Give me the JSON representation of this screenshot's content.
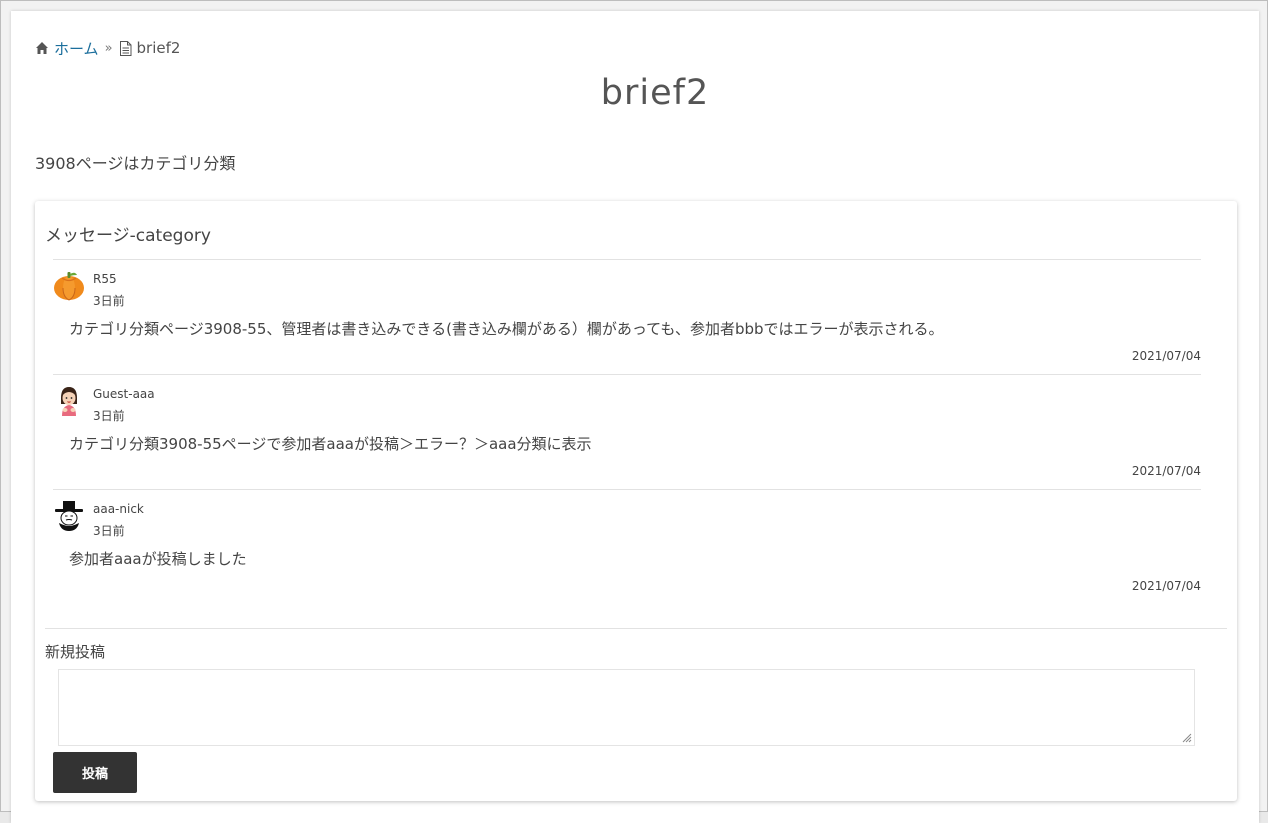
{
  "breadcrumb": {
    "home_label": "ホーム",
    "separator": "»",
    "current": "brief2"
  },
  "page": {
    "title": "brief2",
    "intro": "3908ページはカテゴリ分類"
  },
  "message_card": {
    "title": "メッセージ-category",
    "messages": [
      {
        "author": "R55",
        "ago": "3日前",
        "body": "カテゴリ分類ページ3908-55、管理者は書き込みできる(書き込み欄がある）欄があっても、参加者bbbではエラーが表示される。",
        "date": "2021/07/04",
        "avatar": "pumpkin-icon"
      },
      {
        "author": "Guest-aaa",
        "ago": "3日前",
        "body": "カテゴリ分類3908-55ページで参加者aaaが投稿＞エラー？＞aaa分類に表示",
        "date": "2021/07/04",
        "avatar": "girl-avatar-icon"
      },
      {
        "author": "aaa-nick",
        "ago": "3日前",
        "body": "参加者aaaが投稿しました",
        "date": "2021/07/04",
        "avatar": "hat-man-avatar-icon"
      }
    ]
  },
  "new_post": {
    "label": "新規投稿",
    "placeholder": "",
    "button_label": "投稿"
  },
  "colors": {
    "link": "#1b6e9c",
    "button_bg": "#333333",
    "scrollbar_bg": "#f0f0f0"
  }
}
